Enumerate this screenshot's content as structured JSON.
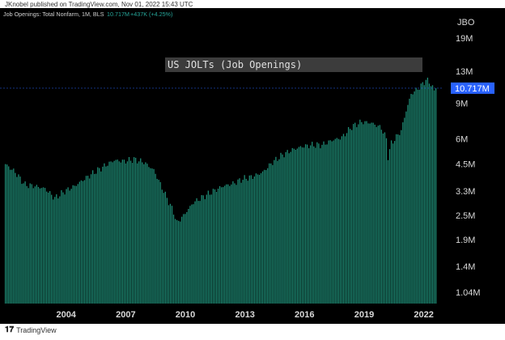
{
  "header": {
    "published": "JKnobel published on TradingView.com, Nov 01, 2022 15:43 UTC"
  },
  "footer": {
    "brand": "TradingView"
  },
  "symbol": {
    "name": "Job Openings: Total Nonfarm, 1M, BLS",
    "value": "10.717M",
    "change": "+437K (+4.25%)",
    "ticker": "JBO"
  },
  "colors": {
    "background": "#000000",
    "bar": "#1f8f78",
    "change": "#26a69a",
    "last_badge": "#2962ff",
    "annotation_bg": "#3c3c3c"
  },
  "chart_data": {
    "type": "bar",
    "title": "US JOLTs (Job Openings)",
    "y_scale": "log",
    "ylim": [
      0.9,
      25
    ],
    "y_tick_labels": [
      "19M",
      "13M",
      "9M",
      "6M",
      "4.5M",
      "3.3M",
      "2.5M",
      "1.9M",
      "1.4M",
      "1.04M"
    ],
    "y_tick_values": [
      19,
      13,
      9,
      6,
      4.5,
      3.3,
      2.5,
      1.9,
      1.4,
      1.04
    ],
    "x_tick_labels": [
      "2004",
      "2007",
      "2010",
      "2013",
      "2016",
      "2019",
      "2022"
    ],
    "last_value": 10.717,
    "keypoints": [
      [
        "2000-12",
        4.5
      ],
      [
        "2001-06",
        4.1
      ],
      [
        "2001-12",
        3.55
      ],
      [
        "2002-06",
        3.5
      ],
      [
        "2002-12",
        3.4
      ],
      [
        "2003-06",
        3.05
      ],
      [
        "2003-12",
        3.3
      ],
      [
        "2004-06",
        3.5
      ],
      [
        "2004-12",
        3.8
      ],
      [
        "2005-06",
        4.1
      ],
      [
        "2005-12",
        4.4
      ],
      [
        "2006-06",
        4.7
      ],
      [
        "2006-12",
        4.65
      ],
      [
        "2007-06",
        4.75
      ],
      [
        "2007-12",
        4.6
      ],
      [
        "2008-06",
        4.2
      ],
      [
        "2008-12",
        3.3
      ],
      [
        "2009-06",
        2.6
      ],
      [
        "2009-08",
        2.3
      ],
      [
        "2009-12",
        2.5
      ],
      [
        "2010-06",
        2.9
      ],
      [
        "2010-12",
        3.1
      ],
      [
        "2011-06",
        3.3
      ],
      [
        "2011-12",
        3.5
      ],
      [
        "2012-06",
        3.6
      ],
      [
        "2012-12",
        3.8
      ],
      [
        "2013-06",
        3.9
      ],
      [
        "2013-12",
        4.1
      ],
      [
        "2014-06",
        4.6
      ],
      [
        "2014-12",
        5.0
      ],
      [
        "2015-06",
        5.3
      ],
      [
        "2015-12",
        5.5
      ],
      [
        "2016-06",
        5.6
      ],
      [
        "2016-12",
        5.6
      ],
      [
        "2017-06",
        5.9
      ],
      [
        "2017-12",
        6.1
      ],
      [
        "2018-06",
        6.9
      ],
      [
        "2018-12",
        7.3
      ],
      [
        "2019-06",
        7.2
      ],
      [
        "2019-12",
        6.8
      ],
      [
        "2020-03",
        6.0
      ],
      [
        "2020-04",
        4.9
      ],
      [
        "2020-06",
        5.7
      ],
      [
        "2020-12",
        6.6
      ],
      [
        "2021-03",
        8.3
      ],
      [
        "2021-06",
        10.0
      ],
      [
        "2021-12",
        11.0
      ],
      [
        "2022-03",
        11.8
      ],
      [
        "2022-06",
        11.3
      ],
      [
        "2022-08",
        10.3
      ],
      [
        "2022-09",
        10.717
      ]
    ]
  }
}
